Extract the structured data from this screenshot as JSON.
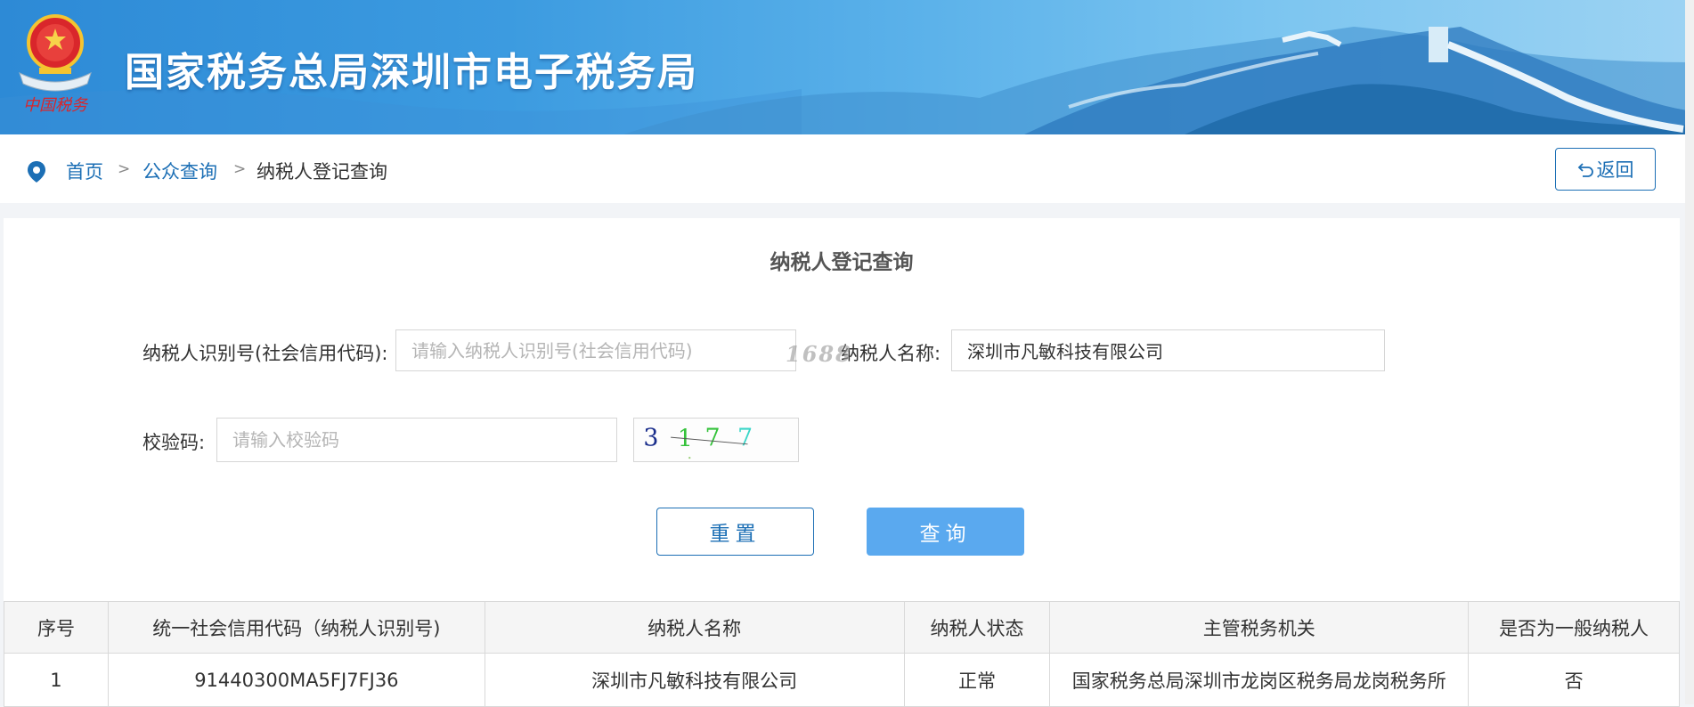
{
  "header": {
    "site_title": "国家税务总局深圳市电子税务局",
    "emblem_caption": "中国税务"
  },
  "breadcrumb": {
    "items": [
      {
        "label": "首页"
      },
      {
        "label": "公众查询"
      },
      {
        "label": "纳税人登记查询"
      }
    ],
    "separator": ">",
    "back_label": "返回"
  },
  "form": {
    "title": "纳税人登记查询",
    "taxpayer_id_label": "纳税人识别号(社会信用代码):",
    "taxpayer_id_placeholder": "请输入纳税人识别号(社会信用代码)",
    "taxpayer_id_value": "",
    "taxpayer_name_label": "纳税人名称:",
    "taxpayer_name_value": "深圳市凡敏科技有限公司",
    "captcha_label": "校验码:",
    "captcha_placeholder": "请输入校验码",
    "captcha_image_text": "3177",
    "reset_label": "重置",
    "query_label": "查询"
  },
  "watermark": "1688",
  "table": {
    "headers": [
      "序号",
      "统一社会信用代码（纳税人识别号)",
      "纳税人名称",
      "纳税人状态",
      "主管税务机关",
      "是否为一般纳税人"
    ],
    "rows": [
      [
        "1",
        "91440300MA5FJ7FJ36",
        "深圳市凡敏科技有限公司",
        "正常",
        "国家税务总局深圳市龙岗区税务局龙岗税务所",
        "否"
      ]
    ]
  },
  "colors": {
    "link": "#1c6fb5",
    "primary_button": "#5aa9ef",
    "banner": "#3c9be0"
  }
}
